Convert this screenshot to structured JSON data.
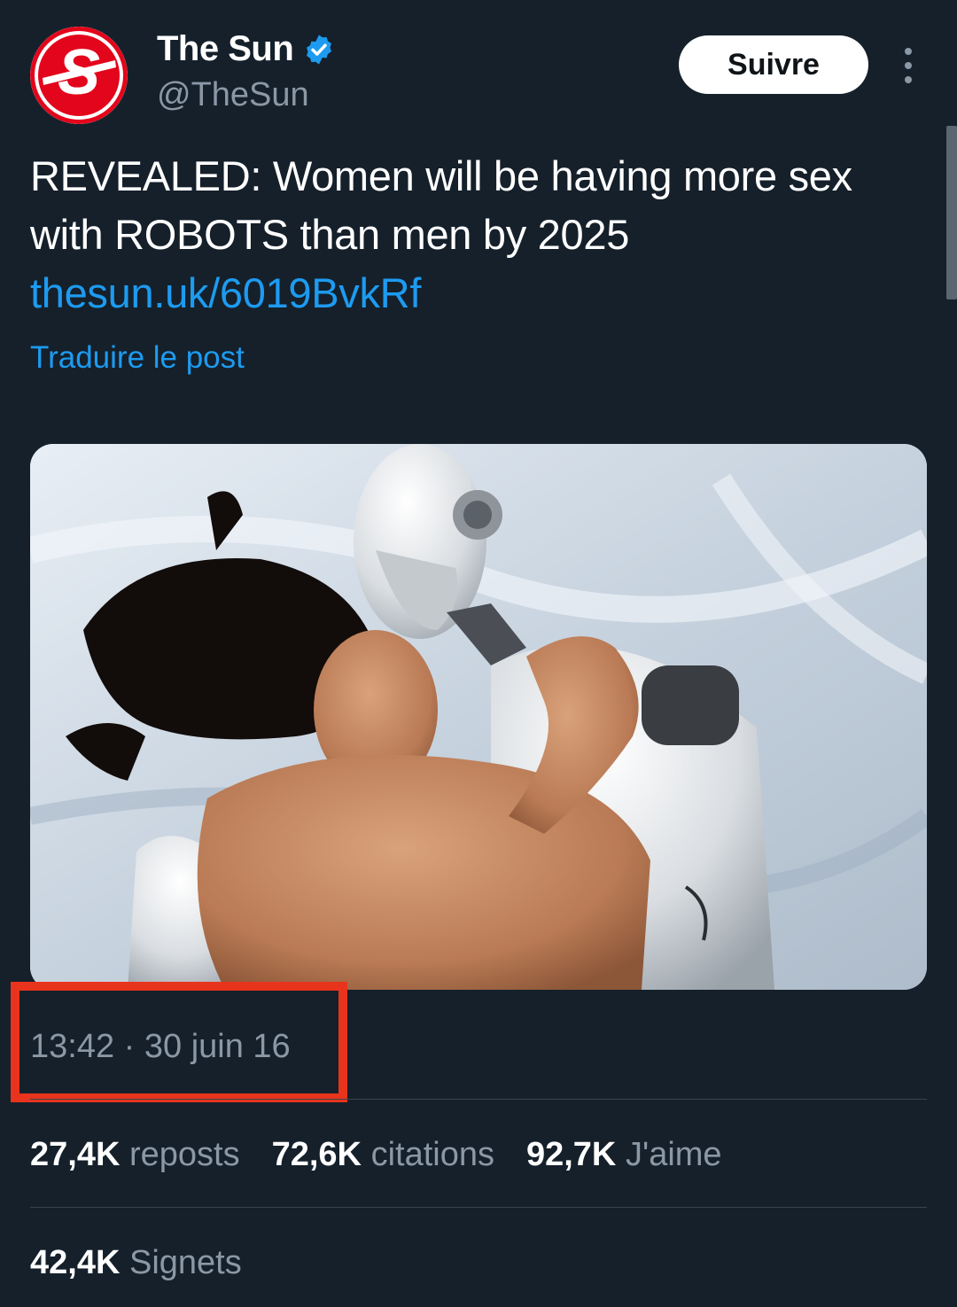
{
  "author": {
    "display_name": "The Sun",
    "handle": "@TheSun",
    "avatar_letter": "S",
    "verified_icon": "verified-badge-icon",
    "brand_color": "#e3051b"
  },
  "actions": {
    "follow_label": "Suivre",
    "more_icon": "more-options-icon"
  },
  "tweet": {
    "text": "REVEALED: Women will be having more sex with ROBOTS than men by 2025 ",
    "link": "thesun.uk/6019BvkRf",
    "translate_label": "Traduire le post",
    "link_color": "#1d9bf0"
  },
  "meta": {
    "timestamp": "13:42 · 30 juin 16",
    "highlight_color": "#e8341c"
  },
  "stats": [
    {
      "count": "27,4K",
      "label": "reposts"
    },
    {
      "count": "72,6K",
      "label": "citations"
    },
    {
      "count": "92,7K",
      "label": "J'aime"
    }
  ],
  "bookmarks": {
    "count": "42,4K",
    "label": "Signets"
  }
}
